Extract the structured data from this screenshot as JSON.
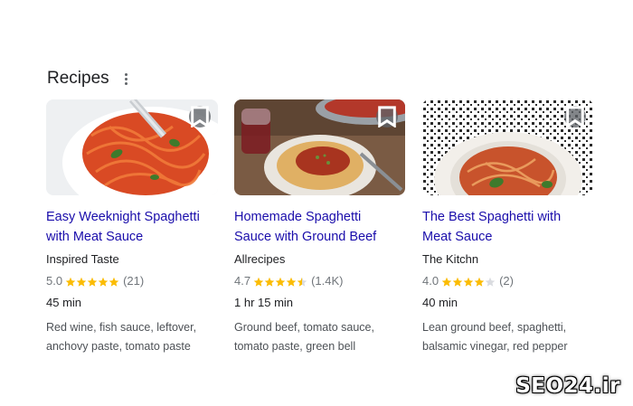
{
  "section": {
    "title": "Recipes",
    "more_icon": "more-vert-icon"
  },
  "colors": {
    "link": "#1a0dab",
    "star": "#fbbc04",
    "star_empty": "#dadce0"
  },
  "recipes": [
    {
      "title_line1": "Easy Weeknight Spaghetti",
      "title_line2": "with Meat Sauce",
      "source": "Inspired Taste",
      "rating": "5.0",
      "stars": 5,
      "reviews": "(21)",
      "time": "45 min",
      "ingredients_line1": "Red wine, fish sauce, leftover,",
      "ingredients_line2": "anchovy paste, tomato paste"
    },
    {
      "title_line1": "Homemade Spaghetti",
      "title_line2": "Sauce with Ground Beef",
      "source": "Allrecipes",
      "rating": "4.7",
      "stars": 4.5,
      "reviews": "(1.4K)",
      "time": "1 hr 15 min",
      "ingredients_line1": "Ground beef, tomato sauce,",
      "ingredients_line2": "tomato paste, green bell"
    },
    {
      "title_line1": "The Best Spaghetti with",
      "title_line2": "Meat Sauce",
      "source": "The Kitchn",
      "rating": "4.0",
      "stars": 4,
      "reviews": "(2)",
      "time": "40 min",
      "ingredients_line1": "Lean ground beef, spaghetti,",
      "ingredients_line2": "balsamic vinegar, red pepper"
    }
  ],
  "watermark": "SEO24.ir"
}
